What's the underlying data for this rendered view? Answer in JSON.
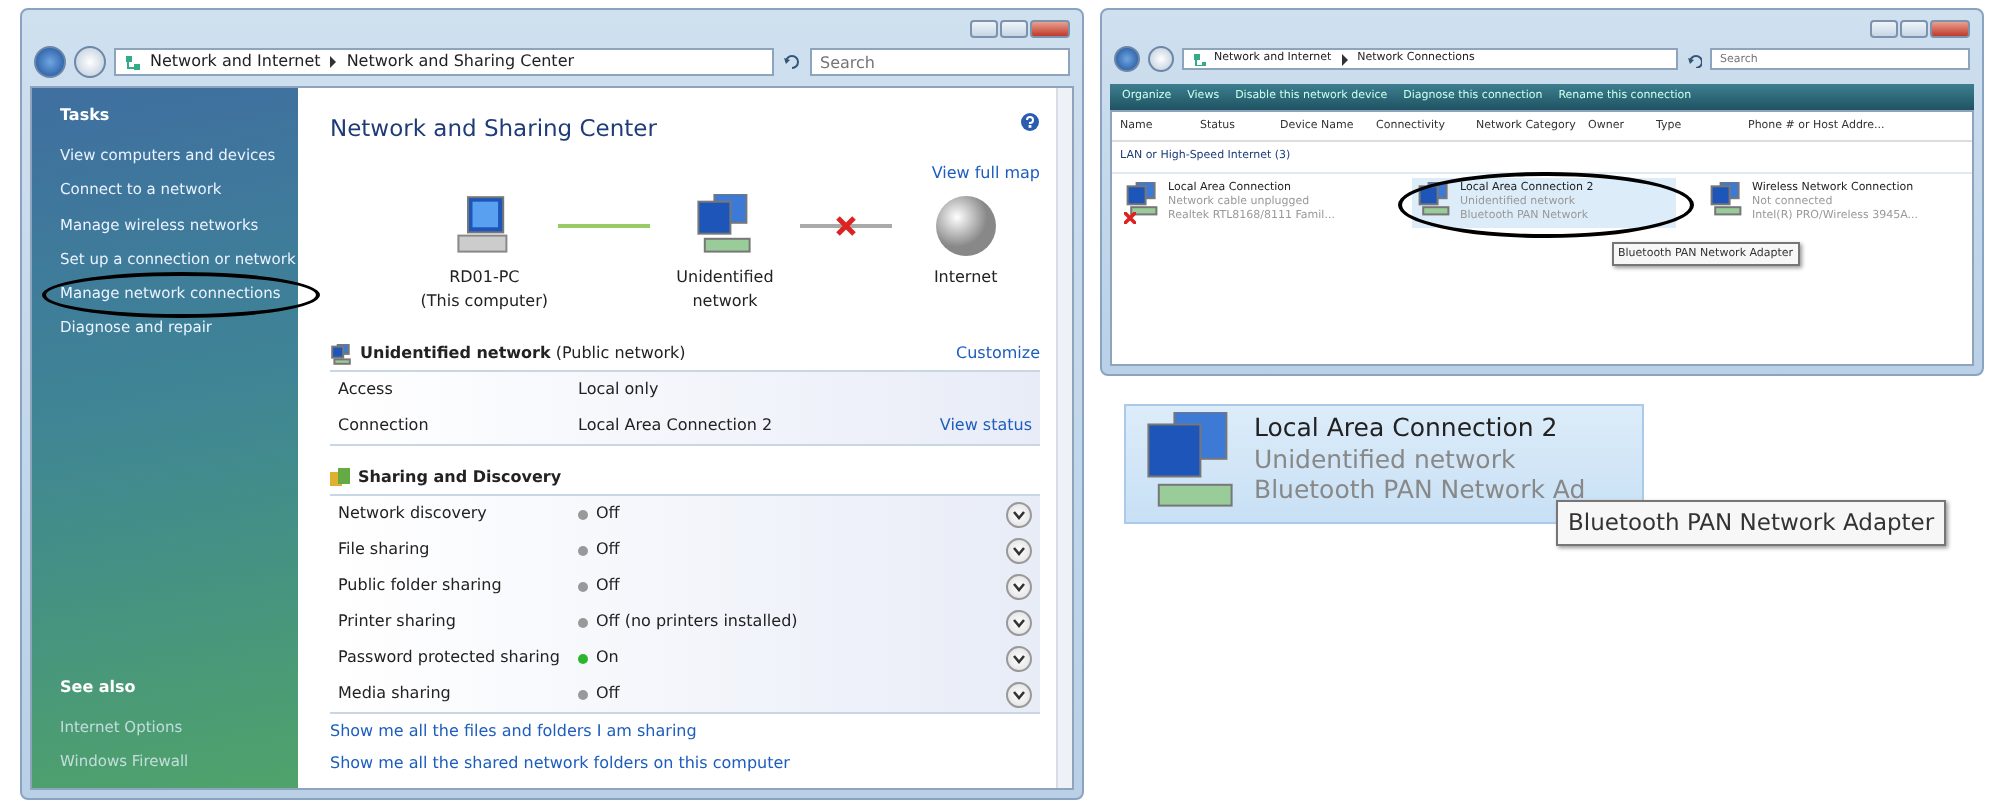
{
  "main_window": {
    "address": [
      "Network and Internet",
      "Network and Sharing Center"
    ],
    "search_placeholder": "Search",
    "sidebar": {
      "heading": "Tasks",
      "tasks": [
        {
          "label": "View computers and devices",
          "circled": false
        },
        {
          "label": "Connect to a network",
          "circled": false
        },
        {
          "label": "Manage wireless networks",
          "circled": false
        },
        {
          "label": "Set up a connection or network",
          "circled": false
        },
        {
          "label": "Manage network connections",
          "circled": true
        },
        {
          "label": "Diagnose and repair",
          "circled": false
        }
      ],
      "see_also_heading": "See also",
      "see_also": [
        "Internet Options",
        "Windows Firewall"
      ]
    },
    "title": "Network and Sharing Center",
    "view_full_map": "View full map",
    "map": [
      {
        "kind": "computer",
        "label": "RD01-PC",
        "sublabel": "(This computer)"
      },
      {
        "kind": "network",
        "label": "Unidentified network"
      },
      {
        "kind": "internet",
        "label": "Internet"
      }
    ],
    "map_links": [
      {
        "connected": true
      },
      {
        "connected": false
      }
    ],
    "network": {
      "name": "Unidentified network",
      "type": "(Public network)",
      "action": "Customize",
      "rows": [
        {
          "label": "Access",
          "value": "Local only"
        },
        {
          "label": "Connection",
          "value": "Local Area Connection 2",
          "action": "View status"
        }
      ]
    },
    "sharing": {
      "heading": "Sharing and Discovery",
      "rows": [
        {
          "label": "Network discovery",
          "value": "Off",
          "on": false
        },
        {
          "label": "File sharing",
          "value": "Off",
          "on": false
        },
        {
          "label": "Public folder sharing",
          "value": "Off",
          "on": false
        },
        {
          "label": "Printer sharing",
          "value": "Off (no printers installed)",
          "on": false
        },
        {
          "label": "Password protected sharing",
          "value": "On",
          "on": true
        },
        {
          "label": "Media sharing",
          "value": "Off",
          "on": false
        }
      ]
    },
    "links": [
      "Show me all the files and folders I am sharing",
      "Show me all the shared network folders on this computer"
    ]
  },
  "connections_window": {
    "address": [
      "Network and Internet",
      "Network Connections"
    ],
    "search_placeholder": "Search",
    "toolbar": [
      "Organize",
      "Views",
      "Disable this network device",
      "Diagnose this connection",
      "Rename this connection"
    ],
    "columns": [
      "Name",
      "Status",
      "Device Name",
      "Connectivity",
      "Network Category",
      "Owner",
      "Type",
      "Phone # or Host Addre..."
    ],
    "group": "LAN or High-Speed Internet (3)",
    "items": [
      {
        "name": "Local Area Connection",
        "status": "Network cable unplugged",
        "device": "Realtek RTL8168/8111 Famil...",
        "unplugged": true,
        "selected": false,
        "circled": false
      },
      {
        "name": "Local Area Connection 2",
        "status": "Unidentified network",
        "device": "Bluetooth PAN Network",
        "unplugged": false,
        "selected": true,
        "circled": true
      },
      {
        "name": "Wireless Network Connection",
        "status": "Not connected",
        "device": "Intel(R) PRO/Wireless 3945A...",
        "unplugged": false,
        "selected": false,
        "circled": false
      }
    ],
    "tooltip": "Bluetooth PAN Network Adapter"
  },
  "detail": {
    "name": "Local Area Connection 2",
    "status": "Unidentified network",
    "device": "Bluetooth PAN Network Ad",
    "selected": true,
    "tooltip": "Bluetooth PAN Network Adapter"
  }
}
